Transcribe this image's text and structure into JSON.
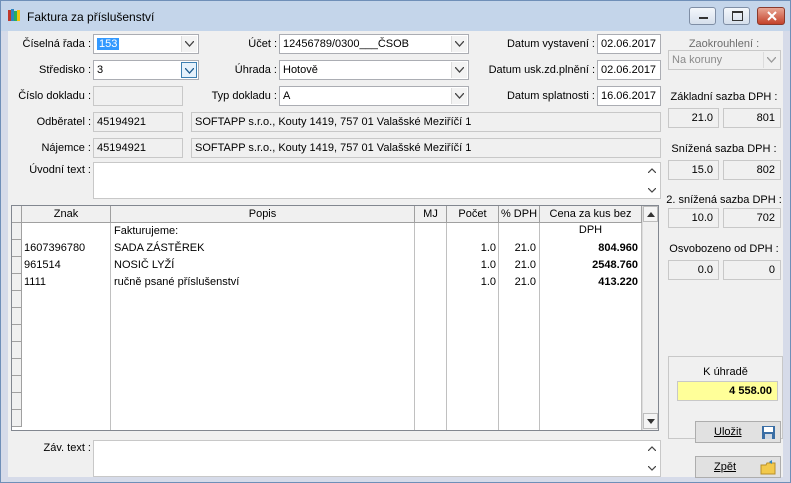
{
  "window": {
    "title": "Faktura za příslušenství"
  },
  "header": {
    "ciselna_rada": {
      "label": "Číselná řada :",
      "value": "153"
    },
    "stredisko": {
      "label": "Středisko :",
      "value": "3"
    },
    "cislo_dokladu": {
      "label": "Číslo dokladu :",
      "value": ""
    },
    "ucet": {
      "label": "Účet :",
      "value": "12456789/0300___ČSOB"
    },
    "uhrada": {
      "label": "Úhrada :",
      "value": "Hotově"
    },
    "typ_dokladu": {
      "label": "Typ dokladu :",
      "value": "A"
    },
    "datum_vystaveni": {
      "label": "Datum vystavení :",
      "value": "02.06.2017"
    },
    "datum_usk": {
      "label": "Datum usk.zd.plnění :",
      "value": "02.06.2017"
    },
    "datum_splatnosti": {
      "label": "Datum splatnosti :",
      "value": "16.06.2017"
    },
    "odberatel": {
      "label": "Odběratel :",
      "code": "45194921",
      "name": "SOFTAPP s.r.o., Kouty 1419, 757 01 Valašské Meziříčí 1"
    },
    "najemce": {
      "label": "Nájemce :",
      "code": "45194921",
      "name": "SOFTAPP s.r.o., Kouty 1419, 757 01 Valašské Meziříčí 1"
    },
    "uvodni_text": {
      "label": "Úvodní text :"
    }
  },
  "table": {
    "columns": [
      "Znak",
      "Popis",
      "MJ",
      "Počet",
      "% DPH",
      "Cena za kus bez DPH"
    ],
    "rows": [
      {
        "znak": "",
        "popis": "Fakturujeme:",
        "mj": "",
        "pocet": "",
        "dph": "",
        "cena": ""
      },
      {
        "znak": "1607396780",
        "popis": "SADA ZÁSTĚREK",
        "mj": "",
        "pocet": "1.0",
        "dph": "21.0",
        "cena": "804.960"
      },
      {
        "znak": "961514",
        "popis": "NOSIČ LYŽÍ",
        "mj": "",
        "pocet": "1.0",
        "dph": "21.0",
        "cena": "2548.760"
      },
      {
        "znak": "1111",
        "popis": "ručně psané příslušenství",
        "mj": "",
        "pocet": "1.0",
        "dph": "21.0",
        "cena": "413.220"
      }
    ],
    "empty_rows": 8
  },
  "zav_text": {
    "label": "Záv. text :"
  },
  "right": {
    "zaokrouhleni": {
      "label": "Zaokrouhlení :",
      "value": "Na koruny"
    },
    "zakladni": {
      "label": "Základní sazba DPH :",
      "rate": "21.0",
      "amount": "801"
    },
    "snizena": {
      "label": "Snížená sazba DPH :",
      "rate": "15.0",
      "amount": "802"
    },
    "snizena2": {
      "label": "2. snížená sazba DPH :",
      "rate": "10.0",
      "amount": "702"
    },
    "osvobozeno": {
      "label": "Osvobozeno od DPH :",
      "rate": "0.0",
      "amount": "0"
    },
    "k_uhrade": {
      "label": "K úhradě",
      "value": "4 558.00"
    }
  },
  "buttons": {
    "ulozit": "Uložit",
    "zpet": "Zpět"
  },
  "icons": {
    "app": "app-books-icon",
    "save": "floppy-disk-icon",
    "back": "folder-back-icon"
  },
  "colors": {
    "selection": "#3399ff",
    "total_bg": "#ffff99",
    "titlebar": "#c4d5ea"
  }
}
